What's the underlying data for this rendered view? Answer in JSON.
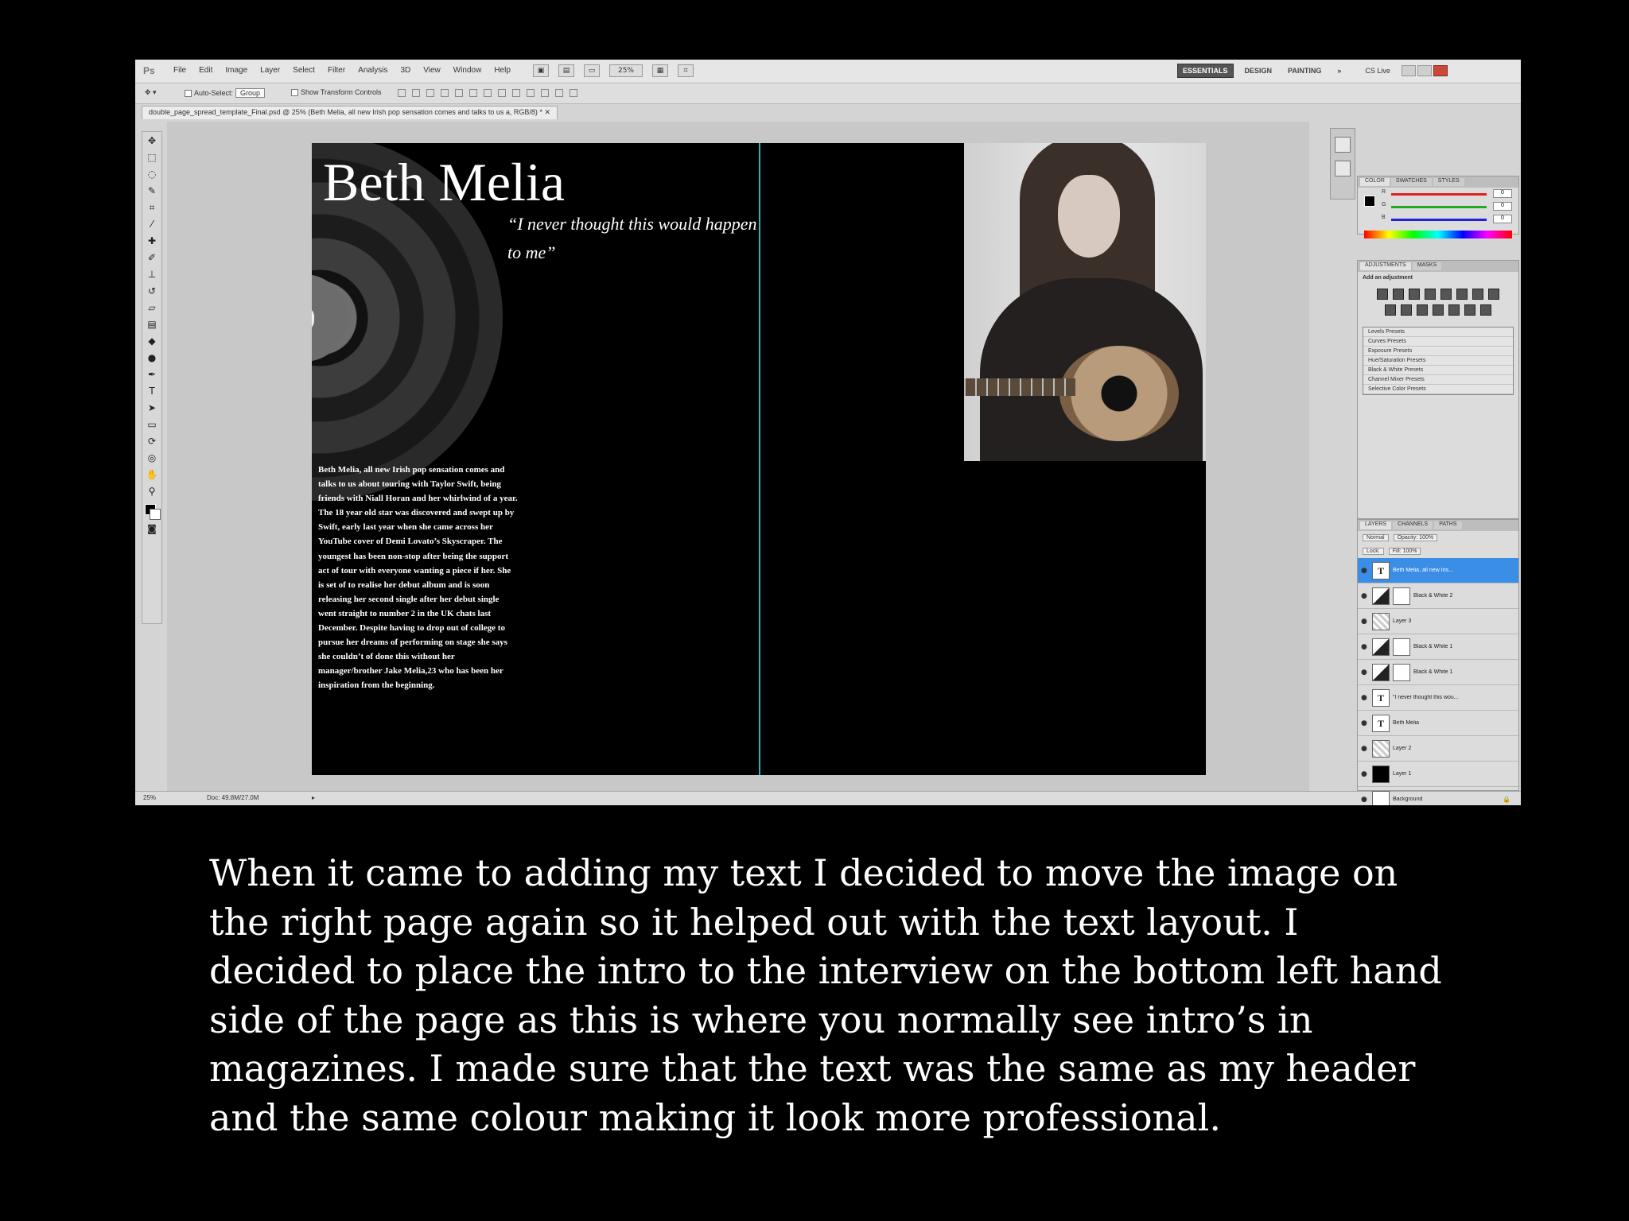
{
  "photoshop": {
    "app_logo": "Ps",
    "menu": [
      "File",
      "Edit",
      "Image",
      "Layer",
      "Select",
      "Filter",
      "Analysis",
      "3D",
      "View",
      "Window",
      "Help"
    ],
    "zoom": "25%",
    "workspaces": [
      "ESSENTIALS",
      "DESIGN",
      "PAINTING",
      "»"
    ],
    "cs_live": "CS Live",
    "options_bar": {
      "auto_select": "Auto-Select:",
      "auto_select_value": "Group",
      "transform_controls": "Show Transform Controls"
    },
    "document_tab": "double_page_spread_template_Final.psd @ 25% (Beth Melia, all new Irish pop sensation comes and talks to us a, RGB/8) *",
    "status": {
      "zoom": "25%",
      "doc_size": "Doc: 49.8M/27.0M"
    },
    "color_panel": {
      "tabs": [
        "COLOR",
        "SWATCHES",
        "STYLES"
      ],
      "channels": [
        {
          "label": "R",
          "value": "0",
          "color": "#d22"
        },
        {
          "label": "G",
          "value": "0",
          "color": "#2a2"
        },
        {
          "label": "B",
          "value": "0",
          "color": "#22d"
        }
      ]
    },
    "adjustments_panel": {
      "tabs": [
        "ADJUSTMENTS",
        "MASKS"
      ],
      "title": "Add an adjustment",
      "presets": [
        "Levels Presets",
        "Curves Presets",
        "Exposure Presets",
        "Hue/Saturation Presets",
        "Black & White Presets",
        "Channel Mixer Presets",
        "Selective Color Presets"
      ]
    },
    "layers_panel": {
      "tabs": [
        "LAYERS",
        "CHANNELS",
        "PATHS"
      ],
      "blend_mode": "Normal",
      "opacity": "Opacity: 100%",
      "lock": "Lock:",
      "fill": "Fill: 100%",
      "layers": [
        {
          "name": "Beth Melia, all new Iris...",
          "kind": "text",
          "selected": true
        },
        {
          "name": "Black & White 2",
          "kind": "adjustment",
          "selected": false
        },
        {
          "name": "Layer 3",
          "kind": "pixel",
          "selected": false
        },
        {
          "name": "Black & White 1",
          "kind": "adjustment",
          "selected": false
        },
        {
          "name": "Black & White 1",
          "kind": "adjustment",
          "selected": false
        },
        {
          "name": "\"I never thought this wou...",
          "kind": "text",
          "selected": false
        },
        {
          "name": "Beth Melia",
          "kind": "text",
          "selected": false
        },
        {
          "name": "Layer 2",
          "kind": "pixel",
          "selected": false
        },
        {
          "name": "Layer 1",
          "kind": "fill-black",
          "selected": false
        },
        {
          "name": "Background",
          "kind": "background",
          "selected": false
        }
      ]
    }
  },
  "spread": {
    "headline": "Beth Melia",
    "pull_quote": "“I never thought this would happen to me”",
    "intro": "Beth Melia, all new Irish pop sensation comes and talks to us about touring with Taylor Swift, being friends with Niall Horan and her whirlwind of a year. The 18 year old star was discovered and swept up by Swift, early last year when she came across her YouTube cover of Demi Lovato’s Skyscraper. The youngest has been non-stop after being the support act of tour with everyone wanting a piece if her. She is set of to realise her debut album and is soon releasing her second single after her debut single went straight to number 2 in the UK chats last December. Despite having to drop out of college to pursue her dreams of performing on stage she says she couldn’t of done this without her manager/brother Jake Melia,23 who has been her inspiration from the beginning."
  },
  "caption": "When it came to adding my text I decided to move the image on the right page again so it helped out with the text layout. I decided to place the intro to the interview on the bottom left hand side of the page as this is where you normally see intro’s in magazines. I made sure that the text was the same as my header and the same colour making it look more professional."
}
